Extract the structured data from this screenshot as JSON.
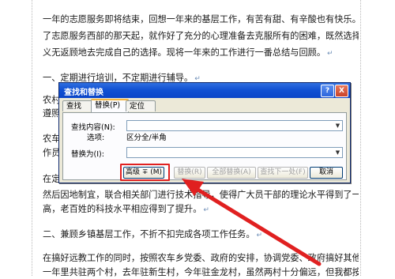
{
  "document": {
    "paragraphs": [
      "一年的志愿服务即将结束，回想一年来的基层工作，有苦有甜、有辛酸也有快乐。自从选择",
      "了志愿服务西部的那天起，就作好了充分的心理准备去克服所有的困难，既然选择了，就得",
      "义无返顾地去完成自己的选择。现将一年来的工作进行一番总结与回顾。",
      "一、定期进行培训，不定期进行辅导。",
      "农村",
      "遵照",
      "农车",
      "作员",
      "在定",
      "然后因地制宜，联合相关部门进行技术指导，使得广大员干部的理论水平得到了一定程度的提",
      "高，老百姓的科技水平相应得到了提升。",
      "二、兼顾乡镇基层工作，不折不扣完成各项工作任务。",
      "在搞好远教工作的同时，按照农车乡党委、政府的安排，协调党委、政府搞好其他各项工作。",
      "一年里共驻两个村，去年驻新生村，今年驻金龙村，虽然两村十分偏远，但我都按时完成了"
    ],
    "paragraph_mark": "↵"
  },
  "dialog": {
    "title": "查找和替换",
    "help_glyph": "?",
    "close_glyph": "X",
    "tabs": [
      "查找(D)",
      "替换(P)",
      "定位(G)"
    ],
    "active_tab": "替换(P)",
    "find_label": "查找内容(N):",
    "find_value": "",
    "options_label": "选项:",
    "options_value": "区分全/半角",
    "replace_label": "替换为(I):",
    "replace_value": "",
    "buttons": {
      "more": "高级 ∓ (M)",
      "replace": "替换(R)",
      "replace_all": "全部替换(A)",
      "find_next": "查找下一处(F)",
      "cancel": "取消"
    }
  },
  "annotation": {
    "highlight_color": "#e02020",
    "arrow_color": "#e02020"
  }
}
